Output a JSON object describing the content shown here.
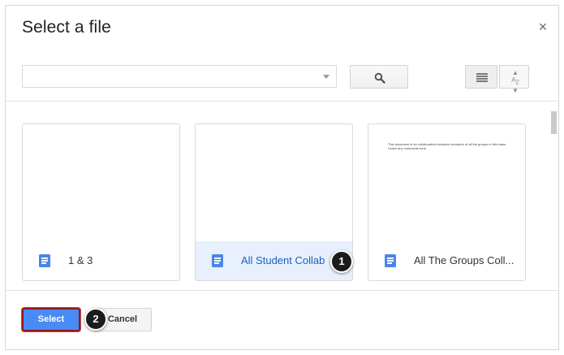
{
  "dialog": {
    "title": "Select a file",
    "close_label": "×"
  },
  "search": {
    "value": "",
    "placeholder": ""
  },
  "files": [
    {
      "name": "1 & 3",
      "selected": false,
      "preview": ""
    },
    {
      "name": "All Student Collab",
      "selected": true,
      "preview": ""
    },
    {
      "name": "All The Groups Coll...",
      "selected": false,
      "preview": "This document is for collaboration between members of all the groups in this class. Leave any comments here."
    }
  ],
  "callouts": [
    "1",
    "2"
  ],
  "footer": {
    "select_label": "Select",
    "cancel_label": "Cancel"
  },
  "icons": {
    "search": "search-icon",
    "list_view": "list-view-icon",
    "sort": "sort-az-icon",
    "document": "google-doc-icon",
    "close": "close-icon"
  },
  "colors": {
    "accent": "#4a8af4",
    "selected_bg": "#e7f0fc",
    "doc_icon": "#4a86e8",
    "highlight_border": "#8b1a1a"
  }
}
